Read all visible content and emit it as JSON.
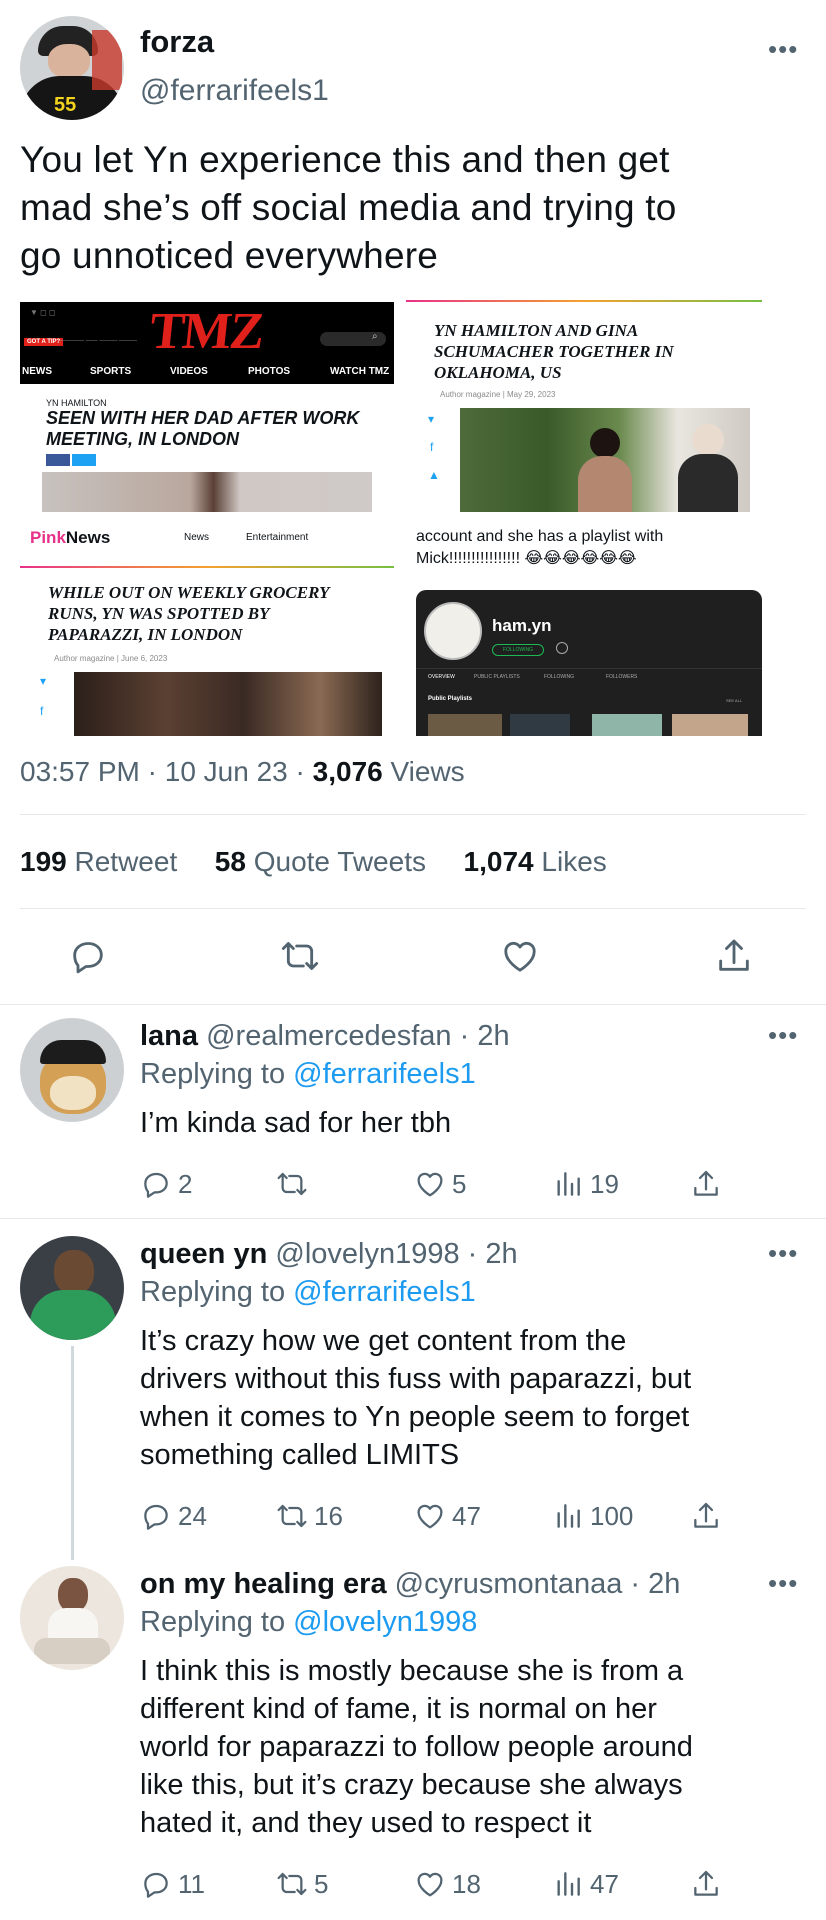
{
  "main_tweet": {
    "display_name": "forza",
    "handle": "@ferrarifeels1",
    "avatar_badge": "55",
    "more": "•••",
    "text_lines": [
      "You let Yn experience this and then get",
      "mad she’s off social media and trying to",
      "go unnoticed everywhere"
    ],
    "time": "03:57 PM",
    "date": "10 Jun 23",
    "views_count": "3,076",
    "views_label": "Views",
    "retweets_count": "199",
    "retweets_label": "Retweet",
    "quotes_count": "58",
    "quotes_label": "Quote Tweets",
    "likes_count": "1,074",
    "likes_label": "Likes"
  },
  "collage": {
    "tmz": {
      "logo": "TMZ",
      "badge": "GOT A TIP?",
      "nav": [
        "NEWS",
        "SPORTS",
        "VIDEOS",
        "PHOTOS",
        "WATCH TMZ"
      ],
      "kicker": "YN HAMILTON",
      "headline_lines": [
        "SEEN WITH HER DAD AFTER WORK",
        "MEETING, IN LONDON"
      ]
    },
    "article1": {
      "headline_lines": [
        "YN HAMILTON AND GINA",
        "SCHUMACHER TOGETHER IN",
        "OKLAHOMA, US"
      ],
      "meta": "Author magazine | May 29, 2023"
    },
    "pinknews": {
      "logo_pink": "Pink",
      "logo_black": "News",
      "nav": [
        "News",
        "Entertainment"
      ]
    },
    "article2": {
      "headline_lines": [
        "WHILE OUT ON WEEKLY GROCERY",
        "RUNS, YN WAS SPOTTED BY",
        "PAPARAZZI, IN LONDON"
      ],
      "meta": "Author magazine | June 6, 2023"
    },
    "spotify_tweet": {
      "line1": "account and she has a playlist with",
      "line2": "Mick!!!!!!!!!!!!!!!! 😂😂😂😂😂😂"
    },
    "spotify": {
      "username": "ham.yn",
      "following_btn": "FOLLOWING",
      "tabs": [
        "OVERVIEW",
        "PUBLIC PLAYLISTS",
        "FOLLOWING",
        "FOLLOWERS"
      ],
      "section": "Public Playlists",
      "see_all": "SEE ALL"
    }
  },
  "replies": [
    {
      "display_name": "lana",
      "handle": "@realmercedesfan",
      "age": "2h",
      "replying_label": "Replying to",
      "replying_to": "@ferrarifeels1",
      "body_lines": [
        "I’m kinda sad for her tbh"
      ],
      "replies": "2",
      "retweets": "",
      "likes": "5",
      "views": "19"
    },
    {
      "display_name": "queen yn",
      "handle": "@lovelyn1998",
      "age": "2h",
      "replying_label": "Replying to",
      "replying_to": "@ferrarifeels1",
      "body_lines": [
        "It’s crazy how we get content from the",
        "drivers without this fuss with paparazzi, but",
        "when it comes to Yn people seem to forget",
        "something called LIMITS"
      ],
      "replies": "24",
      "retweets": "16",
      "likes": "47",
      "views": "100"
    },
    {
      "display_name": "on my healing era",
      "handle": "@cyrusmontanaa",
      "age": "2h",
      "replying_label": "Replying to",
      "replying_to": "@lovelyn1998",
      "body_lines": [
        "I think this is mostly because she is from a",
        "different kind of fame, it is normal on her",
        "world for paparazzi to follow people around",
        "like this, but it’s crazy because she always",
        "hated it, and they used to respect it"
      ],
      "replies": "11",
      "retweets": "5",
      "likes": "18",
      "views": "47"
    }
  ],
  "colors": {
    "link": "#1d9bf0",
    "muted": "#536471",
    "text": "#0f1419",
    "tmz_red": "#e0201b",
    "pink": "#e8318a"
  }
}
